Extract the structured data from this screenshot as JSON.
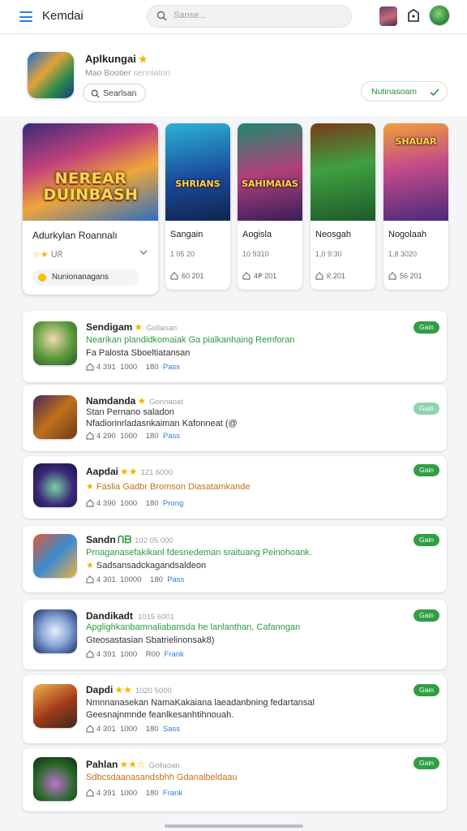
{
  "topbar": {
    "title": "Kemdai",
    "search_placeholder": "Sanse..."
  },
  "header": {
    "app_name": "Aplkungai",
    "app_star": "★",
    "app_sub": "Mao Bootier",
    "app_sub_dim": "senniaton",
    "search_btn": "Searlsan",
    "manage_btn": "Nutinasoam"
  },
  "featured": {
    "art_title": "NEREAR DUINBASH",
    "name": "Adurkylan Roannalı",
    "rating": "☆★",
    "rating_extra": "ᑌᖇ",
    "chip": "Nunionanagans"
  },
  "games": [
    {
      "art_title": "SHRIANS",
      "name": "Sangain",
      "meta": "1 05 20",
      "stat": "60 201"
    },
    {
      "art_title": "SAHIMAIAS",
      "name": "Aogisla",
      "meta": "10 9310",
      "stat": "4ᑭ 201"
    },
    {
      "art_title": "",
      "name": "Neosgah",
      "meta": "1,0 9:30",
      "stat": "ᖇ.201"
    },
    {
      "art_title": "SHAUAR",
      "name": "Nogolaah",
      "meta": "1,8 3020",
      "stat": "56 201"
    }
  ],
  "list": [
    {
      "title": "Sendigam",
      "title_mark": "★",
      "title_meta": "Gollaoan",
      "line1": "Nearikan plandidkomaiak Ga pialkanhaing Remforan",
      "line1_color": "#2b9a3e",
      "line2": "Fa Palosta Sboeltiatansan",
      "line2_color": "#333333",
      "stats_a": "4 391",
      "stats_b": "1000",
      "stats_c": "180",
      "stats_d": "Pass",
      "badge": "Gain",
      "badge_light": false
    },
    {
      "title": "Namdanda",
      "title_mark": "★",
      "title_meta": "Gonnaoat",
      "line1": "Stan Pernano saladon",
      "line1_color": "#333333",
      "line2": "Nfadiorinrladasnkaiman Kafonneat (@",
      "line2_color": "#333333",
      "stats_a": "4 290",
      "stats_b": "1000",
      "stats_c": "180",
      "stats_d": "Pass",
      "badge": "Gain",
      "badge_light": true
    },
    {
      "title": "Aapdai",
      "title_mark": "★★",
      "title_meta": "121 6000",
      "line1": "Faslia Gadbr Bromson Diasatamkande",
      "line1_color": "#c0701a",
      "line2": "",
      "line2_color": "#333333",
      "stats_a": "4 390",
      "stats_b": "1000",
      "stats_c": "180",
      "stats_d": "Prong",
      "badge": "Gain",
      "badge_light": false
    },
    {
      "title": "Sandn",
      "title_mark": "ᑎᗷ",
      "title_meta": "102 05 000",
      "line1": "Prnaganasefakikanl fdesnedeman sraituang Peinohoank.",
      "line1_color": "#2b9a3e",
      "line2": "Sadsansadckagandsaldeon",
      "line2_color": "#333333",
      "stats_a": "4 301",
      "stats_b": "10000",
      "stats_c": "180",
      "stats_d": "Pass",
      "badge": "Gain",
      "badge_light": false
    },
    {
      "title": "Dandikadt",
      "title_mark": "",
      "title_meta": "1015 6001",
      "line1": "Apglighkanbamnaliabansda he lanlanthan, Cafanngan",
      "line1_color": "#2b9a3e",
      "line2": "Gteosastasian Sbatrielinonsak8)",
      "line2_color": "#333333",
      "stats_a": "4 391",
      "stats_b": "1000",
      "stats_c": "R00",
      "stats_d": "Frank",
      "badge": "Gain",
      "badge_light": false
    },
    {
      "title": "Dapdi",
      "title_mark": "★★",
      "title_meta": "1020 5000",
      "line1": "Nmnnanasekan NamaKakaiana laeadanbning fedartansal",
      "line1_color": "#333333",
      "line2": "Geesnajnmnde feanlkesanhtihnouah.",
      "line2_color": "#333333",
      "stats_a": "4 301",
      "stats_b": "1000",
      "stats_c": "180",
      "stats_d": "Sass",
      "badge": "Gain",
      "badge_light": false
    },
    {
      "title": "Pahlan",
      "title_mark": "★★☆",
      "title_meta": "Gollaoan",
      "line1": "Sdbcsdaanasandsbhh Gdanalbeldaau",
      "line1_color": "#c0701a",
      "line2": "",
      "line2_color": "#333333",
      "stats_a": "4 391",
      "stats_b": "1000",
      "stats_c": "180",
      "stats_d": "Frank",
      "badge": "Gain",
      "badge_light": false
    }
  ],
  "colors": {
    "accent": "#2a7de1",
    "green": "#2f9e44",
    "star": "#f5b301"
  }
}
